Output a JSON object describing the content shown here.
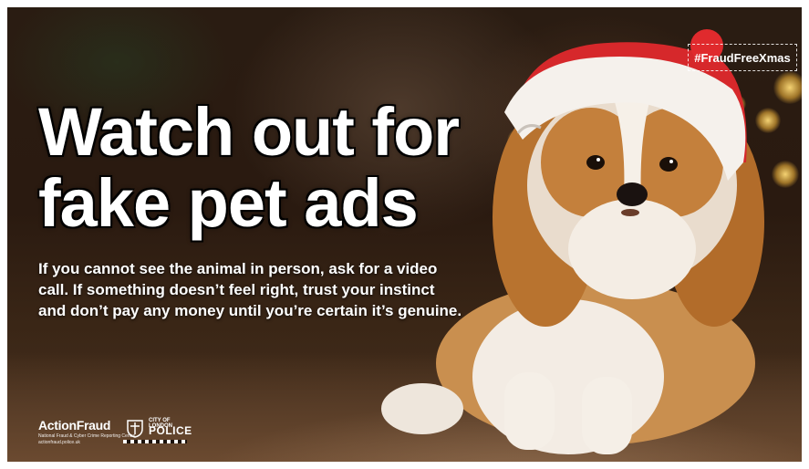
{
  "ad": {
    "hashtag": "#FraudFreeXmas",
    "headline_line1": "Watch out for",
    "headline_line2": "fake pet ads",
    "body_line1": "If you cannot see the animal in person, ask for a video",
    "body_line2": "call. If something doesn’t feel right, trust your instinct",
    "body_line3": "and don’t pay any money until you’re certain it’s genuine."
  },
  "logos": {
    "action_fraud_name": "ActionFraud",
    "action_fraud_tagline": "National Fraud & Cyber Crime Reporting Centre",
    "action_fraud_url": "actionfraud.police.uk",
    "city_of_london": "CITY OF LONDON",
    "police": "POLICE"
  },
  "colors": {
    "text": "#ffffff",
    "hat_red": "#d6282b",
    "fur_tan": "#b8732f"
  }
}
